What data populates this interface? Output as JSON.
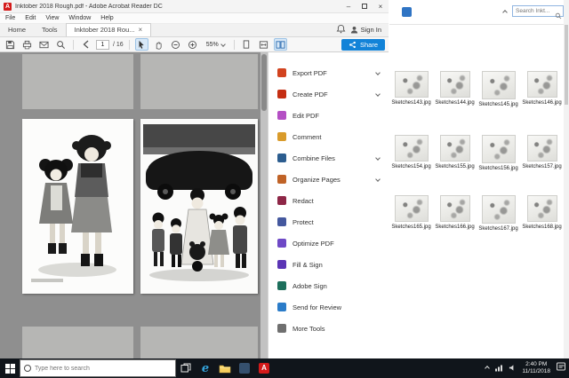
{
  "acrobat": {
    "title": "Inktober 2018 Rough.pdf - Adobe Acrobat Reader DC",
    "window_controls": {
      "minimize": "–",
      "close": "×"
    },
    "menu": {
      "items": [
        "File",
        "Edit",
        "View",
        "Window",
        "Help"
      ]
    },
    "tab_bar": {
      "home_tab": "Home",
      "tools_tab": "Tools",
      "document_tab": "Inktober 2018 Rou...",
      "document_tab_close": "×",
      "sign_in_label": "Sign In"
    },
    "toolbar": {
      "page_number": "1",
      "page_count": "/ 16",
      "zoom_level": "55%",
      "share_label": "Share",
      "share_color": "#1283d8",
      "icons": [
        "save",
        "print",
        "email",
        "search",
        "previous-page",
        "selection-tool",
        "hand-tool",
        "zoom-out",
        "zoom-in",
        "single-page-view",
        "fit-width",
        "two-page-view",
        "share"
      ]
    },
    "tools_panel": {
      "items": [
        {
          "label": "Export PDF",
          "color": "#d2431f",
          "has_chevron": true
        },
        {
          "label": "Create PDF",
          "color": "#c52e12",
          "has_chevron": true
        },
        {
          "label": "Edit PDF",
          "color": "#b44fc4",
          "has_chevron": false
        },
        {
          "label": "Comment",
          "color": "#d99b2b",
          "has_chevron": false
        },
        {
          "label": "Combine Files",
          "color": "#2c5d8f",
          "has_chevron": true
        },
        {
          "label": "Organize Pages",
          "color": "#c06327",
          "has_chevron": true
        },
        {
          "label": "Redact",
          "color": "#8e2747",
          "has_chevron": false
        },
        {
          "label": "Protect",
          "color": "#44589e",
          "has_chevron": false
        },
        {
          "label": "Optimize PDF",
          "color": "#6e49c6",
          "has_chevron": false
        },
        {
          "label": "Fill & Sign",
          "color": "#5b35b5",
          "has_chevron": false
        },
        {
          "label": "Adobe Sign",
          "color": "#1d6f5c",
          "has_chevron": false
        },
        {
          "label": "Send for Review",
          "color": "#2b7cc9",
          "has_chevron": false
        },
        {
          "label": "More Tools",
          "color": "#6f6f6f",
          "has_chevron": false
        }
      ]
    },
    "document": {
      "left_page_alt": "ink-wash illustration of two girls",
      "right_page_alt": "ink-wash illustration of family group in front of a car"
    }
  },
  "explorer": {
    "search_placeholder": "Search Inkt...",
    "files": [
      "Sketches143.jpg",
      "Sketches144.jpg",
      "Sketches145.jpg",
      "Sketches146.jpg",
      "Sketches154.jpg",
      "Sketches155.jpg",
      "Sketches156.jpg",
      "Sketches157.jpg",
      "Sketches165.jpg",
      "Sketches166.jpg",
      "Sketches167.jpg",
      "Sketches168.jpg"
    ]
  },
  "taskbar": {
    "search_placeholder": "Type here to search",
    "time": "2:40 PM",
    "date": "11/11/2018"
  },
  "colors": {
    "accent_blue": "#1283d8",
    "adobe_red": "#d41a1a",
    "taskbar_bg": "#10151b",
    "doc_area_bg": "#8f8f8f"
  }
}
